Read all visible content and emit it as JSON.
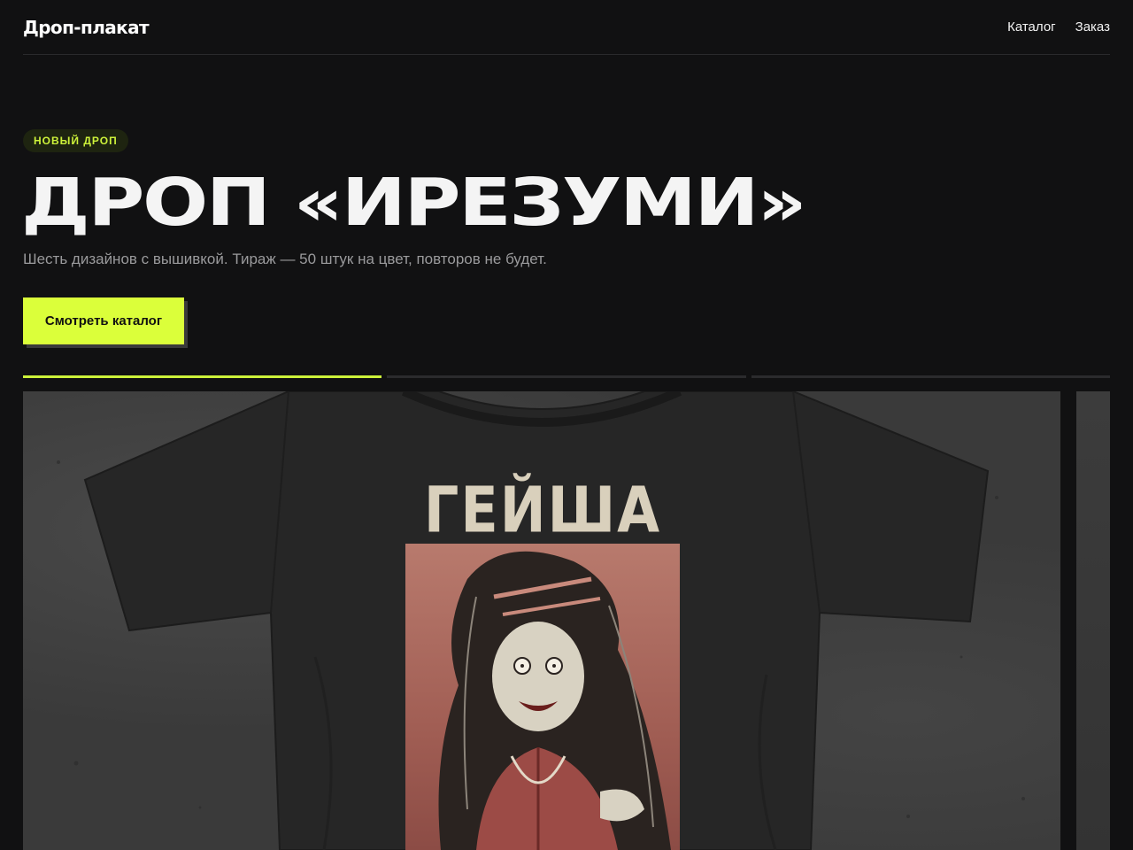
{
  "header": {
    "logo": "Дроп-плакат",
    "nav": [
      {
        "label": "Каталог"
      },
      {
        "label": "Заказ"
      }
    ]
  },
  "hero": {
    "badge": "НОВЫЙ ДРОП",
    "title": "ДРОП «ИРЕЗУМИ»",
    "subtitle": "Шесть дизайнов с вышивкой. Тираж — 50 штук на цвет, повторов не будет.",
    "cta_label": "Смотреть каталог"
  },
  "carousel": {
    "progress": [
      1.0,
      0.0,
      0.0
    ],
    "accent": "#cdf23a",
    "slide": {
      "print_word": "ГЕЙША"
    }
  }
}
